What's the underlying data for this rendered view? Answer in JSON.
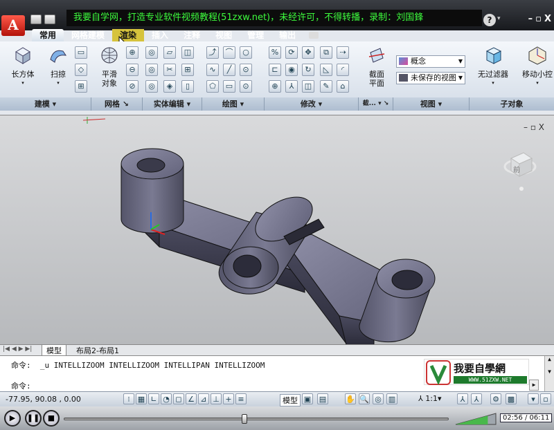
{
  "titlebar": {
    "caption": "我要自学网，打造专业软件视频教程(51zxw.net)，未经许可，不得转播，录制：刘国鋒",
    "help": "?",
    "win_controls": [
      "–",
      "▫",
      "X"
    ]
  },
  "tabs": [
    "常用",
    "网格建模",
    "渲染",
    "插入",
    "注释",
    "视图",
    "管理",
    "输出"
  ],
  "ribbon": {
    "big_buttons": [
      "长方体",
      "扫掠",
      "平滑\n对象",
      "截面\n平面",
      "无过滤器",
      "移动小控"
    ],
    "visual_style": "概念",
    "view_name": "未保存的视图",
    "panels": [
      "建模 ▾",
      "网格 ↘",
      "实体编辑 ▾",
      "绘图 ▾",
      "修改 ▾",
      "截... ▾ ↘",
      "视图 ▾",
      "子对象"
    ]
  },
  "viewport": {
    "controls": "– ▫ X",
    "viewcube_label": "前"
  },
  "layout_tabs": [
    "模型",
    "布局2-布局1"
  ],
  "command": {
    "history": "命令:  _u INTELLIZOOM INTELLIZOOM INTELLIPAN INTELLIZOOM",
    "prompt": "命令:"
  },
  "brand": {
    "name": "我要自學網",
    "url": "WWW.51ZXW.NET"
  },
  "status": {
    "coords": "-77.95, 90.08 , 0.00",
    "model": "模型",
    "scale": "1:1"
  },
  "player": {
    "time": "02:56 / 06:11",
    "progress": 0.47,
    "volume": 0.8
  }
}
